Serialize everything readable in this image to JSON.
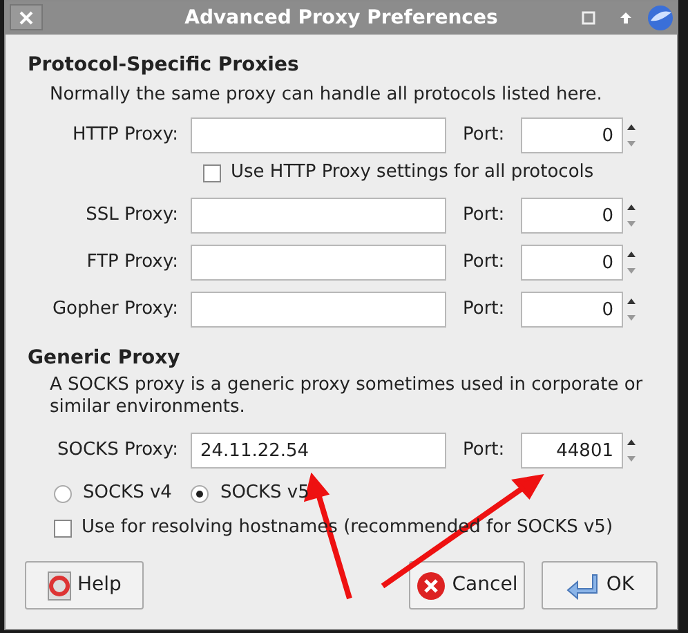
{
  "window": {
    "title": "Advanced Proxy Preferences"
  },
  "protocol_section": {
    "heading": "Protocol-Specific Proxies",
    "description": "Normally the same proxy can handle all protocols listed here.",
    "proxies": [
      {
        "label": "HTTP Proxy:",
        "port_label": "Port:",
        "port": "0"
      },
      {
        "label": "SSL Proxy:",
        "port_label": "Port:",
        "port": "0"
      },
      {
        "label": "FTP Proxy:",
        "port_label": "Port:",
        "port": "0"
      },
      {
        "label": "Gopher Proxy:",
        "port_label": "Port:",
        "port": "0"
      }
    ],
    "use_same": {
      "label": "Use HTTP Proxy settings for all protocols",
      "checked": false
    }
  },
  "generic_section": {
    "heading": "Generic Proxy",
    "description": "A SOCKS proxy is a generic proxy sometimes used in corporate or similar environments.",
    "socks": {
      "label": "SOCKS Proxy:",
      "value": "24.11.22.54",
      "port_label": "Port:",
      "port": "44801"
    },
    "versions": [
      {
        "label": "SOCKS v4",
        "selected": false
      },
      {
        "label": "SOCKS v5",
        "selected": true
      }
    ],
    "resolve": {
      "label": "Use for resolving hostnames (recommended for SOCKS v5)",
      "checked": false
    }
  },
  "buttons": [
    {
      "kind": "help",
      "label": "Help"
    },
    {
      "kind": "cancel",
      "label": "Cancel"
    },
    {
      "kind": "ok",
      "label": "OK"
    }
  ]
}
